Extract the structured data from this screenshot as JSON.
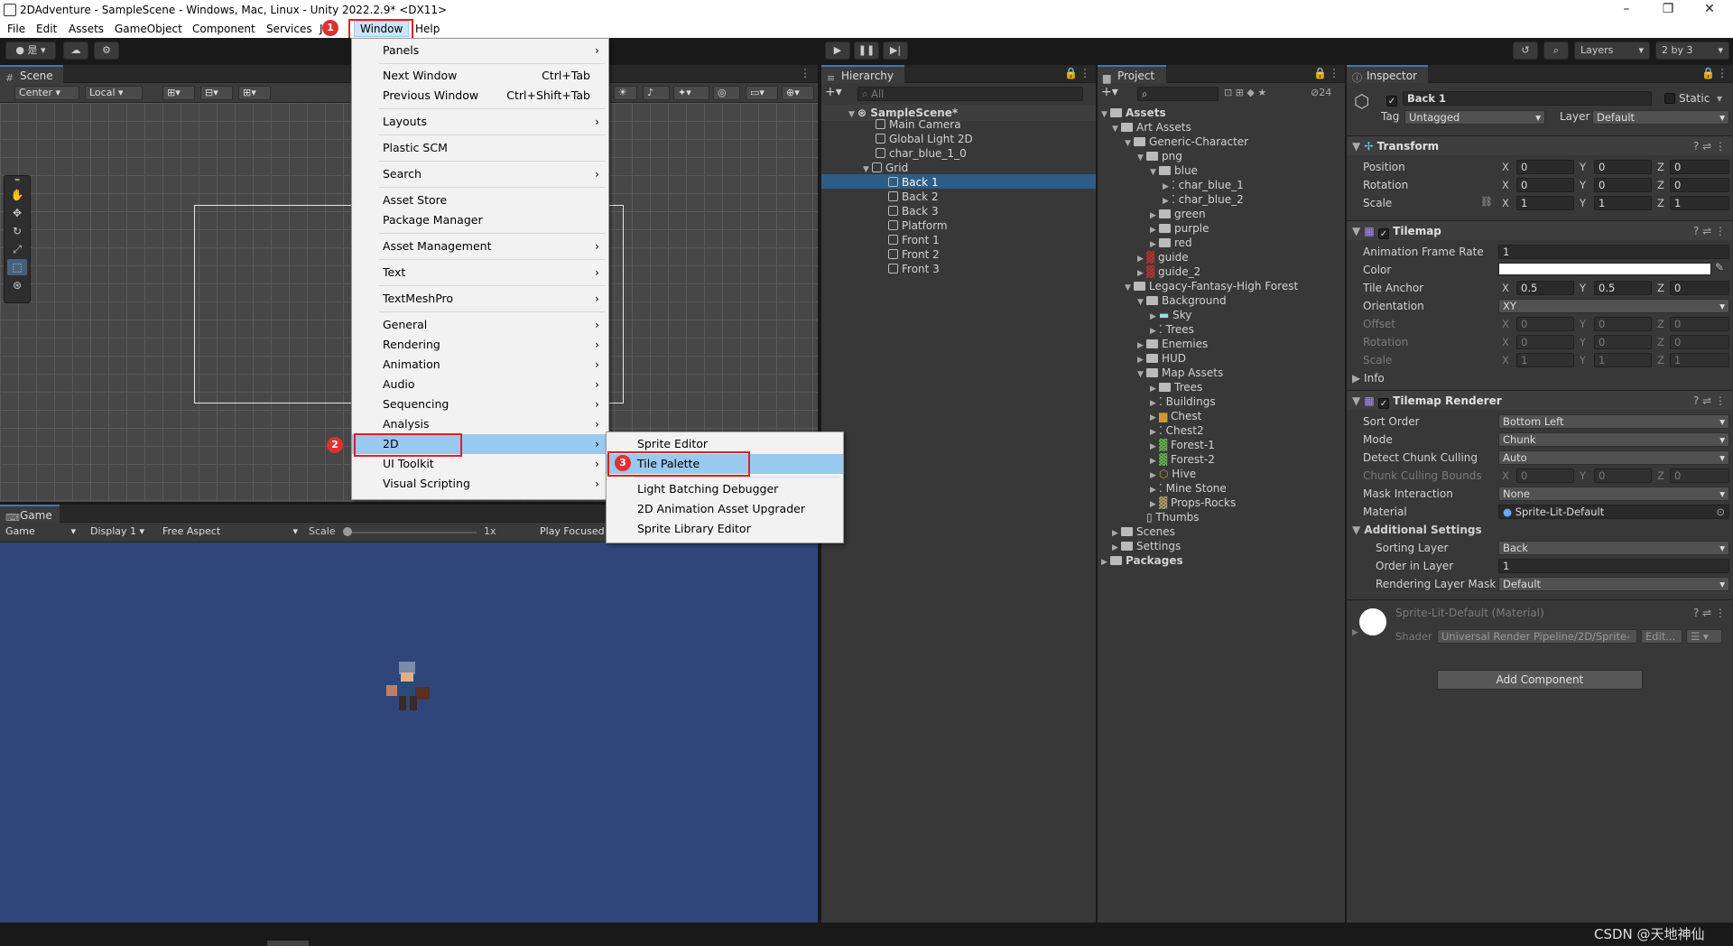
{
  "window": {
    "title": "2DAdventure - SampleScene - Windows, Mac, Linux - Unity 2022.2.9* <DX11>"
  },
  "menubar": [
    "File",
    "Edit",
    "Assets",
    "GameObject",
    "Component",
    "Services",
    "Window",
    "Help"
  ],
  "menubar_hidden": "Ja",
  "toolbar": {
    "account_label": "是",
    "layers_label": "Layers",
    "layout_label": "2 by 3"
  },
  "scene": {
    "tab": "Scene",
    "pivot": "Center",
    "space": "Local"
  },
  "game": {
    "tab": "Game",
    "mode": "Game",
    "display": "Display 1",
    "aspect": "Free Aspect",
    "scale_label": "Scale",
    "scale_value": "1x",
    "play_focused": "Play Focused"
  },
  "window_menu": {
    "items": [
      {
        "label": "Panels",
        "shortcut": "",
        "arrow": "›"
      },
      {
        "label": "Next Window",
        "shortcut": "Ctrl+Tab",
        "arrow": ""
      },
      {
        "label": "Previous Window",
        "shortcut": "Ctrl+Shift+Tab",
        "arrow": ""
      },
      {
        "label": "Layouts",
        "shortcut": "",
        "arrow": "›"
      },
      {
        "label": "Plastic SCM",
        "shortcut": "",
        "arrow": ""
      },
      {
        "label": "Search",
        "shortcut": "",
        "arrow": "›"
      },
      {
        "label": "Asset Store",
        "shortcut": "",
        "arrow": ""
      },
      {
        "label": "Package Manager",
        "shortcut": "",
        "arrow": ""
      },
      {
        "label": "Asset Management",
        "shortcut": "",
        "arrow": "›"
      },
      {
        "label": "Text",
        "shortcut": "",
        "arrow": "›"
      },
      {
        "label": "TextMeshPro",
        "shortcut": "",
        "arrow": "›"
      },
      {
        "label": "General",
        "shortcut": "",
        "arrow": "›"
      },
      {
        "label": "Rendering",
        "shortcut": "",
        "arrow": "›"
      },
      {
        "label": "Animation",
        "shortcut": "",
        "arrow": "›"
      },
      {
        "label": "Audio",
        "shortcut": "",
        "arrow": "›"
      },
      {
        "label": "Sequencing",
        "shortcut": "",
        "arrow": "›"
      },
      {
        "label": "Analysis",
        "shortcut": "",
        "arrow": "›"
      },
      {
        "label": "2D",
        "shortcut": "",
        "arrow": "›"
      },
      {
        "label": "UI Toolkit",
        "shortcut": "",
        "arrow": "›"
      },
      {
        "label": "Visual Scripting",
        "shortcut": "",
        "arrow": "›"
      }
    ]
  },
  "submenu_2d": [
    "Sprite Editor",
    "Tile Palette",
    "Light Batching Debugger",
    "2D Animation Asset Upgrader",
    "Sprite Library Editor"
  ],
  "annotations": [
    "1",
    "2",
    "3"
  ],
  "hierarchy": {
    "tab": "Hierarchy",
    "search_placeholder": "All",
    "items": [
      "SampleScene*",
      "Main Camera",
      "Global Light 2D",
      "char_blue_1_0",
      "Grid",
      "Back 1",
      "Back 2",
      "Back 3",
      "Platform",
      "Front 1",
      "Front 2",
      "Front 3"
    ]
  },
  "project": {
    "tab": "Project",
    "count": "24",
    "items": [
      "Assets",
      "Art Assets",
      "Generic-Character",
      "png",
      "blue",
      "char_blue_1",
      "char_blue_2",
      "green",
      "purple",
      "red",
      "guide",
      "guide_2",
      "Legacy-Fantasy-High Forest",
      "Background",
      "Sky",
      "Trees",
      "Enemies",
      "HUD",
      "Map Assets",
      "Trees",
      "Buildings",
      "Chest",
      "Chest2",
      "Forest-1",
      "Forest-2",
      "Hive",
      "Mine Stone",
      "Props-Rocks",
      "Thumbs",
      "Scenes",
      "Settings",
      "Packages"
    ]
  },
  "inspector": {
    "tab": "Inspector",
    "object_name": "Back 1",
    "static_label": "Static",
    "tag_label": "Tag",
    "tag": "Untagged",
    "layer_label": "Layer",
    "layer": "Default",
    "transform": {
      "title": "Transform",
      "position": [
        "0",
        "0",
        "0"
      ],
      "rotation": [
        "0",
        "0",
        "0"
      ],
      "scale": [
        "1",
        "1",
        "1"
      ],
      "labels": [
        "Position",
        "Rotation",
        "Scale"
      ]
    },
    "tilemap": {
      "title": "Tilemap",
      "anim_rate_label": "Animation Frame Rate",
      "anim_rate": "1",
      "color_label": "Color",
      "anchor_label": "Tile Anchor",
      "anchor": [
        "0.5",
        "0.5",
        "0"
      ],
      "orientation_label": "Orientation",
      "orientation": "XY",
      "offset_label": "Offset",
      "offset": [
        "0",
        "0",
        "0"
      ],
      "rotation_label": "Rotation",
      "rotation": [
        "0",
        "0",
        "0"
      ],
      "scale_label": "Scale",
      "scale": [
        "1",
        "1",
        "1"
      ],
      "info_label": "Info"
    },
    "renderer": {
      "title": "Tilemap Renderer",
      "sort_order_label": "Sort Order",
      "sort_order": "Bottom Left",
      "mode_label": "Mode",
      "mode": "Chunk",
      "detect_label": "Detect Chunk Culling Boun",
      "detect": "Auto",
      "bounds_label": "Chunk Culling Bounds",
      "bounds": [
        "0",
        "0",
        "0"
      ],
      "mask_label": "Mask Interaction",
      "mask": "None",
      "material_label": "Material",
      "material": "Sprite-Lit-Default",
      "additional_label": "Additional Settings",
      "sorting_layer_label": "Sorting Layer",
      "sorting_layer": "Back",
      "order_label": "Order in Layer",
      "order": "1",
      "render_mask_label": "Rendering Layer Mask",
      "render_mask": "Default"
    },
    "material": {
      "name": "Sprite-Lit-Default (Material)",
      "shader_label": "Shader",
      "shader": "Universal Render Pipeline/2D/Sprite-",
      "edit": "Edit..."
    },
    "add_component": "Add Component"
  },
  "axes": [
    "X",
    "Y",
    "Z"
  ],
  "watermark": "CSDN @天地神仙"
}
